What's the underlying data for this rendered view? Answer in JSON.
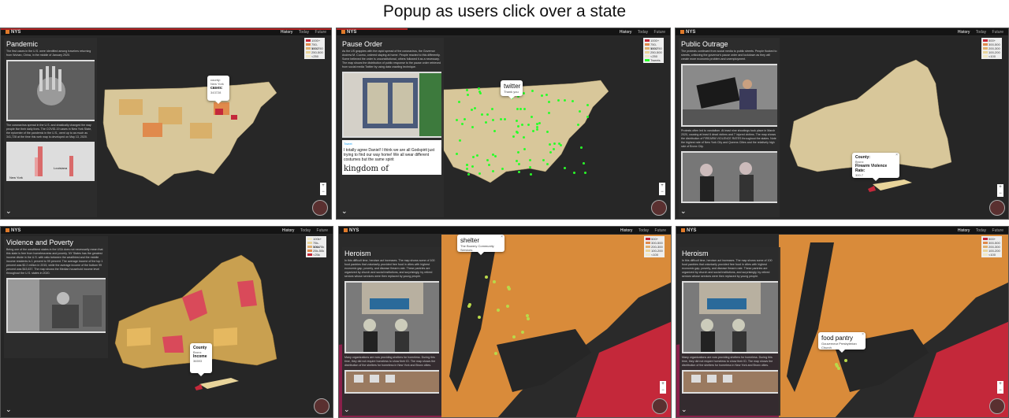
{
  "caption": "Popup as users click over a state",
  "app": {
    "logo": "NYS",
    "tabs": [
      "History",
      "Today",
      "Future"
    ]
  },
  "panels": [
    {
      "title": "Pandemic",
      "text": "The first cases in the U.S. were identified among travelers returning from Wuhan, China, in the middle of January 2020.",
      "text2": "The coronavirus spread in the U.S. and drastically changed the way people live their daily lives. The COVID-19 cases in New York State, the epicenter of the pandemic in the U.S., went up to as much as 341,728 at the time this web map is developed on May 13, 2020.",
      "chart_labels": [
        "New York",
        "Louisiana"
      ],
      "popup": {
        "label": "county:",
        "name": "New York",
        "field": "cases:",
        "value": "343728"
      },
      "legend": [
        "1000+",
        "750-1000",
        "500-750",
        "250-500",
        "<250"
      ]
    },
    {
      "title": "Pause Order",
      "text": "As the US grapples with the rapid spread of the coronavirus, the Governor Andrew M. Cuomo, ordered staying at home. People reacted to this differently. Some believed the order is unconstitutional, others followed it as a necessary. The map shows the distribution of public response to the pause order retrieved from social media Twitter by using data crawling technique.",
      "tweet": {
        "label": "Tweet",
        "text": "I totally agree Daniel! I think we are all Godspirit just trying to find our way home! We all wear different costumes but the same spirit",
        "headline": "kingdom of"
      },
      "popup": {
        "title": "twitter",
        "sub": "Thank you"
      },
      "legend": [
        "1000+",
        "750-1000",
        "500-750",
        "250-500",
        "<250",
        "Tweets"
      ]
    },
    {
      "title": "Public Outrage",
      "text": "The protests continued from social media to public streets. People flocked to streets, criticizing the governor's pause order and lockdown as they will create more economic problem and unemployment.",
      "text2": "Protests often led to vandalism. At least nine shootings took place in March 2020, causing at least 6 dead victims and 7 injured victims. The map shows the distribution of FIREARM VIOLENCE RATES throughout the states. Note the highest rate of New York City and Queens Cities and the relatively high rate of Bronx City.",
      "popup": {
        "label": "County:",
        "name": "Bronx",
        "field": "Firearm Violence Rate:",
        "value": "300.7"
      },
      "legend": [
        "500+",
        "300-500",
        "200-300",
        "100-200",
        "<100"
      ]
    },
    {
      "title": "Violence and Poverty",
      "text": "Being one of the wealthiest states in the USA does not necessarily mean that this state is free from homelessness and poverty. NY States has the greatest income divide in the U.S. with ratio between the wealthiest and the middle income residents is 1 percent to 99 percent. The average income of the top 1 percent was $2.2 million in 2015, while the average income of the bottom 99 percent was $43,637. The map shows the Median household income level throughout the U.S. states in 2020.",
      "popup": {
        "label": "County",
        "name": "Bronx",
        "field": "Income",
        "value": "36593"
      },
      "legend": [
        "100k+",
        "75k-100k",
        "50k-75k",
        "25k-50k",
        "<25k"
      ]
    },
    {
      "title": "Heroism",
      "text": "In this difficult time, heroism act increases. The map shows some of 100 food pantries that voluntarily provided free food in cities with highest economic gap, poverty, and disease firearm rate. These pantries are organized by church and social institutions, and surprisingly, by retired seniors whose services were then replaced by young people.",
      "text2": "Many organizations are now providing shelters for homeless. During this time, they did not require homeless to show their ID. The map shows the distribution of the shelters for homeless in New York and Bronx cities.",
      "popup": {
        "title": "shelter",
        "sub": "The Bowery Community Services"
      },
      "legend": [
        "500+",
        "300-500",
        "200-300",
        "100-200",
        "<100"
      ]
    },
    {
      "title": "Heroism",
      "text": "In this difficult time, heroism act increases. The map shows some of 100 food pantries that voluntarily provided free food in cities with highest economic gap, poverty, and disease firearm rate. These pantries are organized by church and social institutions, and surprisingly, by retired seniors whose services were then replaced by young people.",
      "text2": "Many organizations are now providing shelters for homeless. During this time, they did not require homeless to show their ID. The map shows the distribution of the shelters for homeless in New York and Bronx cities.",
      "popup": {
        "title": "food pantry",
        "sub": "Gouverneur Presbyterian Church"
      },
      "legend": [
        "500+",
        "300-500",
        "200-300",
        "100-200",
        "<100"
      ]
    }
  ],
  "colors": {
    "map_beige": "#d8c79a",
    "map_orange": "#d98b3a",
    "map_red": "#c4283a",
    "map_magenta": "#8a1f4a",
    "water": "#262626",
    "tweet_green": "#29ff29",
    "pin_green": "#b9d94a"
  }
}
